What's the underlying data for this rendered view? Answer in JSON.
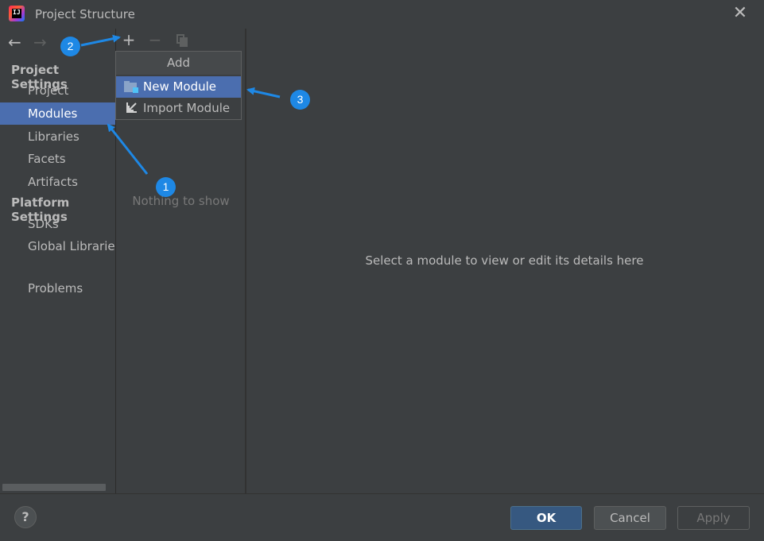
{
  "window": {
    "title": "Project Structure"
  },
  "icons": {
    "app": "intellij-idea-icon",
    "close": "close-icon",
    "back": "arrow-left-icon",
    "forward": "arrow-right-icon",
    "add": "plus-icon",
    "remove": "minus-icon",
    "copy": "copy-icon",
    "new_module": "folder-module-icon",
    "import_module": "import-arrow-icon",
    "help": "question-icon"
  },
  "app_icon_text": "IJ",
  "sidebar": {
    "project_settings_title": "Project Settings",
    "project_items": [
      {
        "label": "Project",
        "selected": false
      },
      {
        "label": "Modules",
        "selected": true
      },
      {
        "label": "Libraries",
        "selected": false
      },
      {
        "label": "Facets",
        "selected": false
      },
      {
        "label": "Artifacts",
        "selected": false
      }
    ],
    "platform_settings_title": "Platform Settings",
    "platform_items": [
      {
        "label": "SDKs"
      },
      {
        "label": "Global Libraries"
      }
    ],
    "problems_label": "Problems"
  },
  "modules_panel": {
    "empty_text": "Nothing to show"
  },
  "details_panel": {
    "placeholder": "Select a module to view or edit its details here"
  },
  "add_popup": {
    "header": "Add",
    "items": [
      {
        "label": "New Module",
        "selected": true
      },
      {
        "label": "Import Module",
        "selected": false
      }
    ]
  },
  "callouts": [
    "1",
    "2",
    "3"
  ],
  "footer": {
    "help_label": "?",
    "ok_label": "OK",
    "cancel_label": "Cancel",
    "apply_label": "Apply"
  },
  "colors": {
    "background": "#3c3f41",
    "selection": "#4b6eaf",
    "ok_button": "#365880",
    "callout": "#1e88e5"
  }
}
